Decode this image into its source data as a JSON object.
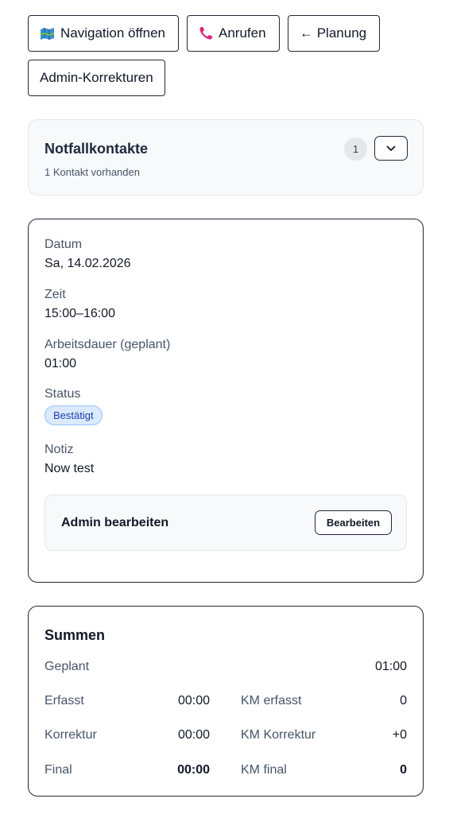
{
  "toolbar": {
    "navigation_label": "Navigation öffnen",
    "call_label": "Anrufen",
    "planning_label": "← Planung",
    "admin_corrections_label": "Admin-Korrekturen"
  },
  "emergency": {
    "title": "Notfallkontakte",
    "subtitle": "1 Kontakt vorhanden",
    "count": "1"
  },
  "details": {
    "date_label": "Datum",
    "date_value": "Sa, 14.02.2026",
    "time_label": "Zeit",
    "time_value": "15:00–16:00",
    "duration_label": "Arbeitsdauer (geplant)",
    "duration_value": "01:00",
    "status_label": "Status",
    "status_value": "Bestätigt",
    "note_label": "Notiz",
    "note_value": "Now test",
    "admin_title": "Admin bearbeiten",
    "admin_button": "Bearbeiten"
  },
  "sums": {
    "title": "Summen",
    "planned_label": "Geplant",
    "planned_value": "01:00",
    "recorded_label": "Erfasst",
    "recorded_value": "00:00",
    "correction_label": "Korrektur",
    "correction_value": "00:00",
    "final_label": "Final",
    "final_value": "00:00",
    "km_recorded_label": "KM erfasst",
    "km_recorded_value": "0",
    "km_correction_label": "KM Korrektur",
    "km_correction_value": "+0",
    "km_final_label": "KM final",
    "km_final_value": "0"
  },
  "colors": {
    "border": "#1f2937",
    "badge_bg": "#dbeafe",
    "badge_text": "#1e40af",
    "phone_icon": "#db2777",
    "map_icon": "#2f7fb8"
  },
  "icons": {
    "navigation": "map-icon",
    "call": "phone-icon",
    "toggle": "chevron-down-icon"
  }
}
